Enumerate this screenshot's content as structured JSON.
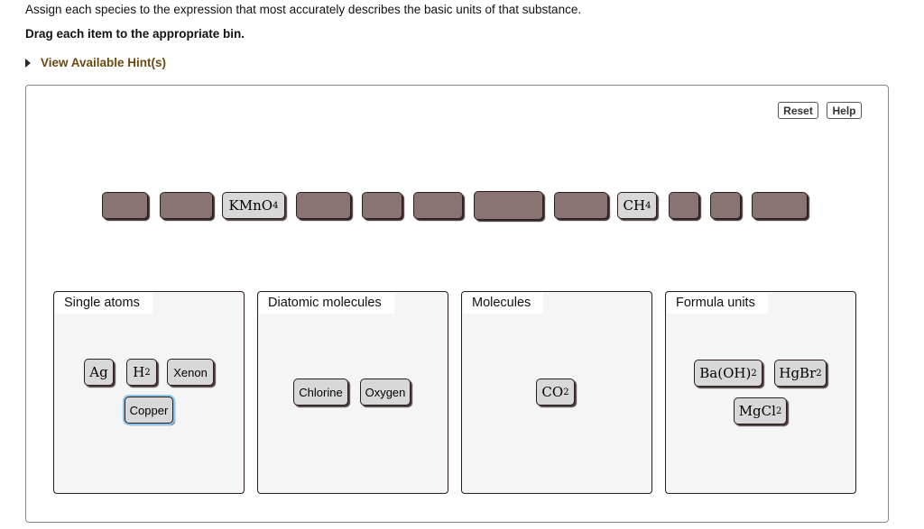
{
  "instructions": {
    "line1": "Assign each species to the expression that most accurately describes the basic units of that substance.",
    "line2": "Drag each item to the appropriate bin.",
    "hint_link": "View Available Hint(s)"
  },
  "toolbar": {
    "reset_label": "Reset",
    "help_label": "Help"
  },
  "source_row": {
    "slots": [
      {
        "filled": false
      },
      {
        "filled": false
      },
      {
        "filled": true,
        "base": "KMnO",
        "sub": "4"
      },
      {
        "filled": false
      },
      {
        "filled": false
      },
      {
        "filled": false
      },
      {
        "filled": false
      },
      {
        "filled": false
      },
      {
        "filled": true,
        "base": "CH",
        "sub": "4"
      },
      {
        "filled": false
      },
      {
        "filled": false
      },
      {
        "filled": false
      }
    ]
  },
  "bins": [
    {
      "label": "Single atoms",
      "items": [
        {
          "base": "Ag",
          "sub": "",
          "type": "formula"
        },
        {
          "base": "H",
          "sub": "2",
          "type": "formula"
        },
        {
          "base": "Xenon",
          "sub": "",
          "type": "word"
        },
        {
          "base": "Copper",
          "sub": "",
          "type": "word",
          "selected": true
        }
      ]
    },
    {
      "label": "Diatomic molecules",
      "items": [
        {
          "base": "Chlorine",
          "sub": "",
          "type": "word"
        },
        {
          "base": "Oxygen",
          "sub": "",
          "type": "word"
        }
      ]
    },
    {
      "label": "Molecules",
      "items": [
        {
          "base": "CO",
          "sub": "2",
          "type": "formula"
        }
      ]
    },
    {
      "label": "Formula units",
      "items": [
        {
          "base": "Ba(OH)",
          "sub": "2",
          "type": "formula"
        },
        {
          "base": "HgBr",
          "sub": "2",
          "type": "formula"
        },
        {
          "base": "MgCl",
          "sub": "2",
          "type": "formula"
        }
      ]
    }
  ]
}
